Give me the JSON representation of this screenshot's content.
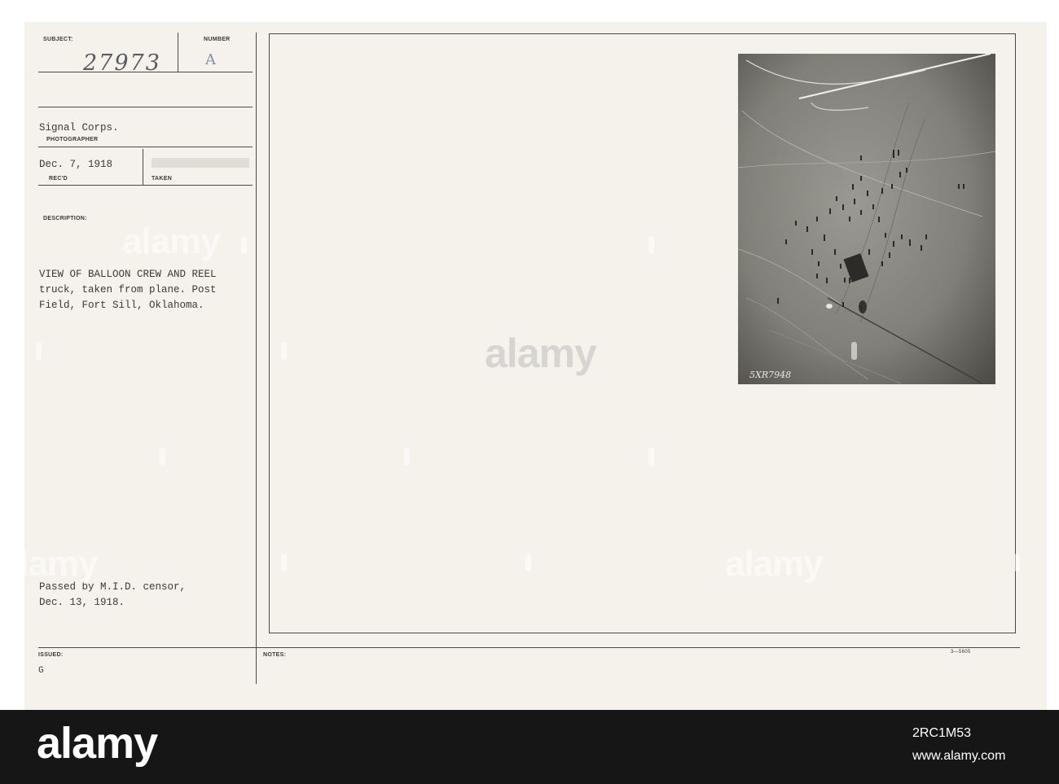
{
  "card": {
    "subject_label": "SUBJECT:",
    "subject_value": "27973",
    "number_label": "NUMBER",
    "number_value": "A",
    "photographer_value": "Signal Corps.",
    "photographer_label": "PHOTOGRAPHER",
    "received_value": "Dec. 7, 1918",
    "received_label": "REC'D",
    "taken_label": "TAKEN",
    "description_label": "DESCRIPTION:",
    "description_lines": [
      "VIEW OF BALLOON CREW AND REEL",
      "truck, taken from plane. Post",
      "Field, Fort Sill, Oklahoma."
    ],
    "censor_lines": [
      "Passed by M.I.D. censor,",
      "Dec. 13, 1918."
    ],
    "issued_label": "ISSUED:",
    "issued_value": "G",
    "notes_label": "NOTES:",
    "form_number": "3—5605"
  },
  "photo": {
    "negative_number": "5XR7948"
  },
  "watermark": {
    "text": "alamy",
    "bottom_text": "alamy",
    "image_id": "2RC1M53",
    "site": "www.alamy.com"
  },
  "colors": {
    "card_background": "#f5f2ec",
    "ink": "#3c3935",
    "bottom_band": "#161616"
  }
}
